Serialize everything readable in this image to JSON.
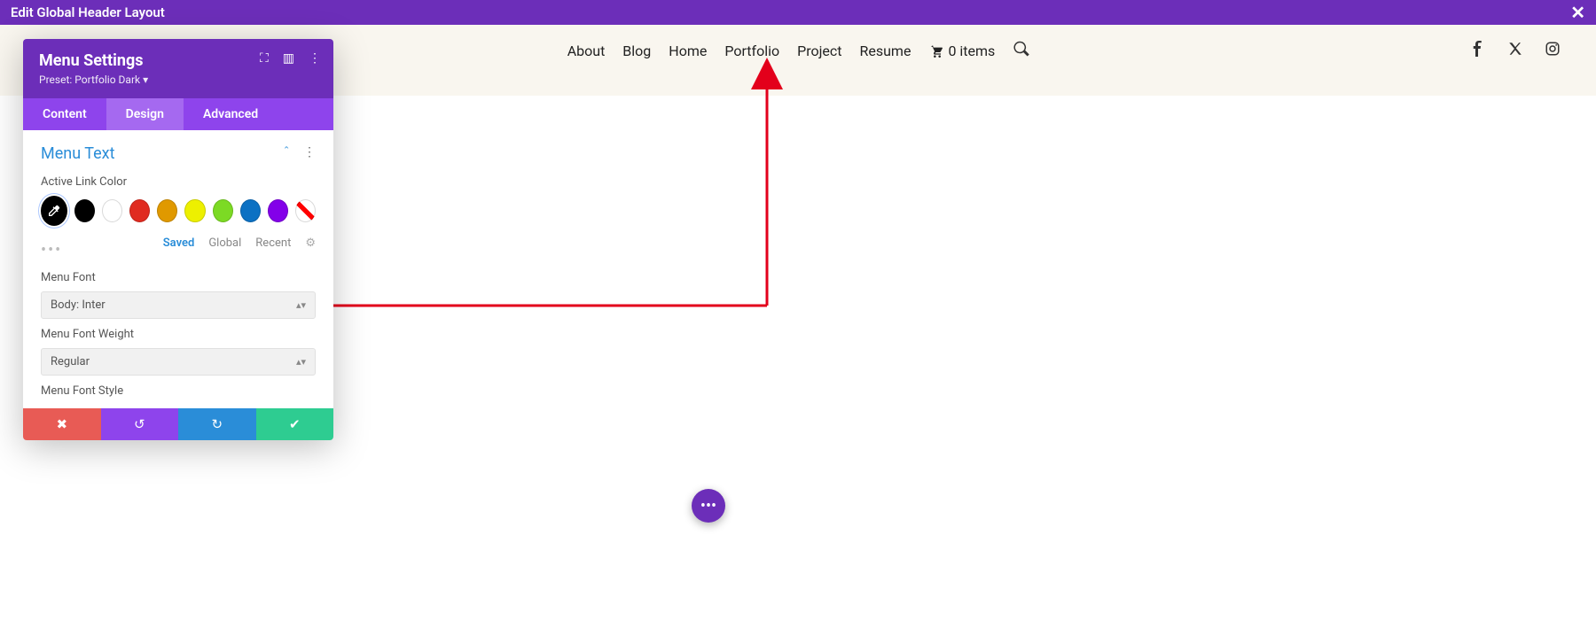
{
  "topbar": {
    "title": "Edit Global Header Layout"
  },
  "nav": {
    "items": [
      "About",
      "Blog",
      "Home",
      "Portfolio",
      "Project",
      "Resume"
    ],
    "cart_label": "0 items"
  },
  "panel": {
    "title": "Menu Settings",
    "preset": "Preset: Portfolio Dark ▾",
    "tabs": {
      "content": "Content",
      "design": "Design",
      "advanced": "Advanced"
    },
    "section": {
      "title": "Menu Text"
    },
    "active_link_color_label": "Active Link Color",
    "swatches": [
      {
        "color": "#000000",
        "active": true,
        "icon": "eyedrop"
      },
      {
        "color": "#000000"
      },
      {
        "color": "#ffffff"
      },
      {
        "color": "#e02b20"
      },
      {
        "color": "#e09900"
      },
      {
        "color": "#edf000"
      },
      {
        "color": "#7cda24"
      },
      {
        "color": "#0c71c3"
      },
      {
        "color": "#8300e9"
      },
      {
        "none": true
      }
    ],
    "palette_tabs": {
      "saved": "Saved",
      "global": "Global",
      "recent": "Recent"
    },
    "menu_font_label": "Menu Font",
    "menu_font_value": "Body: Inter",
    "menu_font_weight_label": "Menu Font Weight",
    "menu_font_weight_value": "Regular",
    "menu_font_style_label": "Menu Font Style"
  }
}
